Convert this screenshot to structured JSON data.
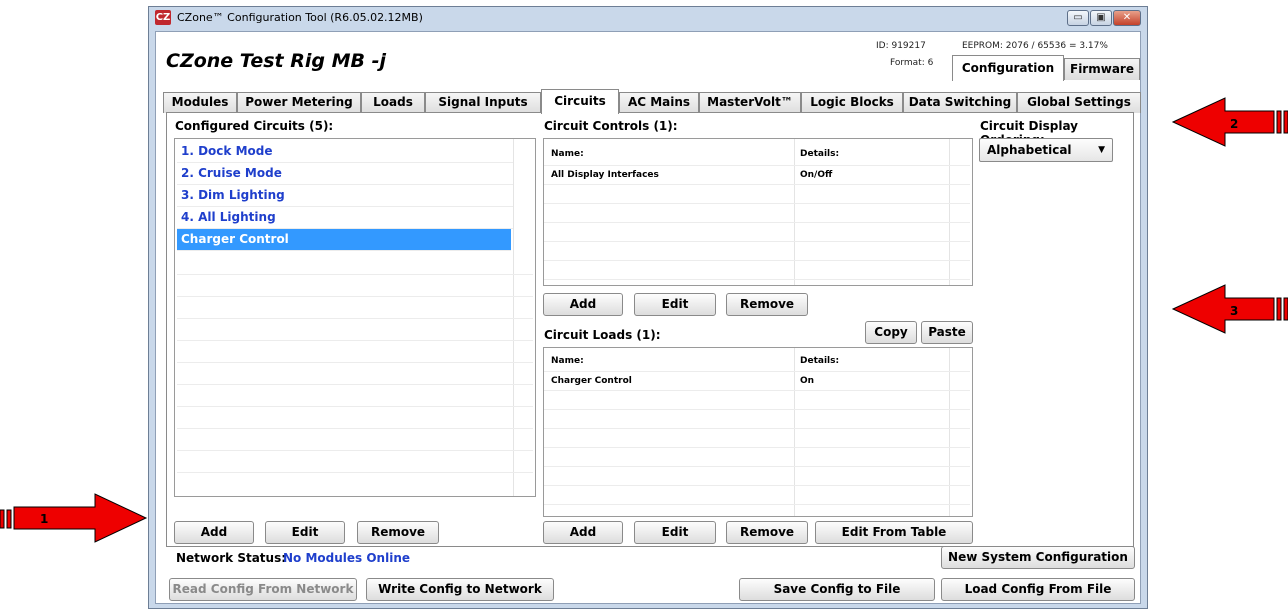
{
  "window": {
    "title": "CZone™ Configuration Tool (R6.05.02.12MB)",
    "icon_text": "CZ",
    "minimize_glyph": "▭",
    "maximize_glyph": "▣",
    "close_glyph": "✕"
  },
  "header": {
    "project_title": "CZone Test Rig MB -j",
    "id_text": "ID: 919217",
    "eeprom_text": "EEPROM: 2076 / 65536 = 3.17%",
    "format_text": "Format: 6",
    "top_tabs": [
      "Configuration",
      "Firmware"
    ],
    "active_top_tab": "Configuration"
  },
  "tabs": [
    "Modules",
    "Power Metering",
    "Loads",
    "Signal Inputs",
    "Circuits",
    "AC Mains",
    "MasterVolt™",
    "Logic Blocks",
    "Data Switching",
    "Global Settings"
  ],
  "active_tab": "Circuits",
  "configured_circuits": {
    "label": "Configured Circuits (5):",
    "items": [
      "1. Dock Mode",
      "2. Cruise Mode",
      "3. Dim Lighting",
      "4. All Lighting",
      "Charger Control"
    ],
    "selected": "Charger Control",
    "buttons": {
      "add": "Add",
      "edit": "Edit",
      "remove": "Remove"
    }
  },
  "circuit_controls": {
    "label": "Circuit Controls (1):",
    "columns": [
      "Name:",
      "Details:"
    ],
    "rows": [
      [
        "All Display Interfaces",
        "On/Off"
      ]
    ],
    "buttons": {
      "add": "Add",
      "edit": "Edit",
      "remove": "Remove"
    }
  },
  "clipboard_buttons": {
    "copy": "Copy",
    "paste": "Paste"
  },
  "circuit_loads": {
    "label": "Circuit Loads (1):",
    "columns": [
      "Name:",
      "Details:"
    ],
    "rows": [
      [
        "Charger Control",
        "On"
      ]
    ],
    "buttons": {
      "add": "Add",
      "edit": "Edit",
      "remove": "Remove",
      "edit_from_table": "Edit From Table"
    }
  },
  "display_ordering": {
    "label": "Circuit Display Ordering:",
    "value": "Alphabetical"
  },
  "status": {
    "label": "Network Status:",
    "value": "No Modules Online",
    "value_color": "#1f3fcc"
  },
  "footer_buttons": {
    "new_system": "New System Configuration",
    "read_config": "Read Config From Network",
    "write_config": "Write Config to Network",
    "save_config": "Save Config to File",
    "load_config": "Load Config From File"
  },
  "annotations": {
    "arrow1": "1",
    "arrow2": "2",
    "arrow3": "3"
  },
  "colors": {
    "arrow": "#ee0000",
    "selection": "#3399ff",
    "link_text": "#1f3fcc"
  }
}
